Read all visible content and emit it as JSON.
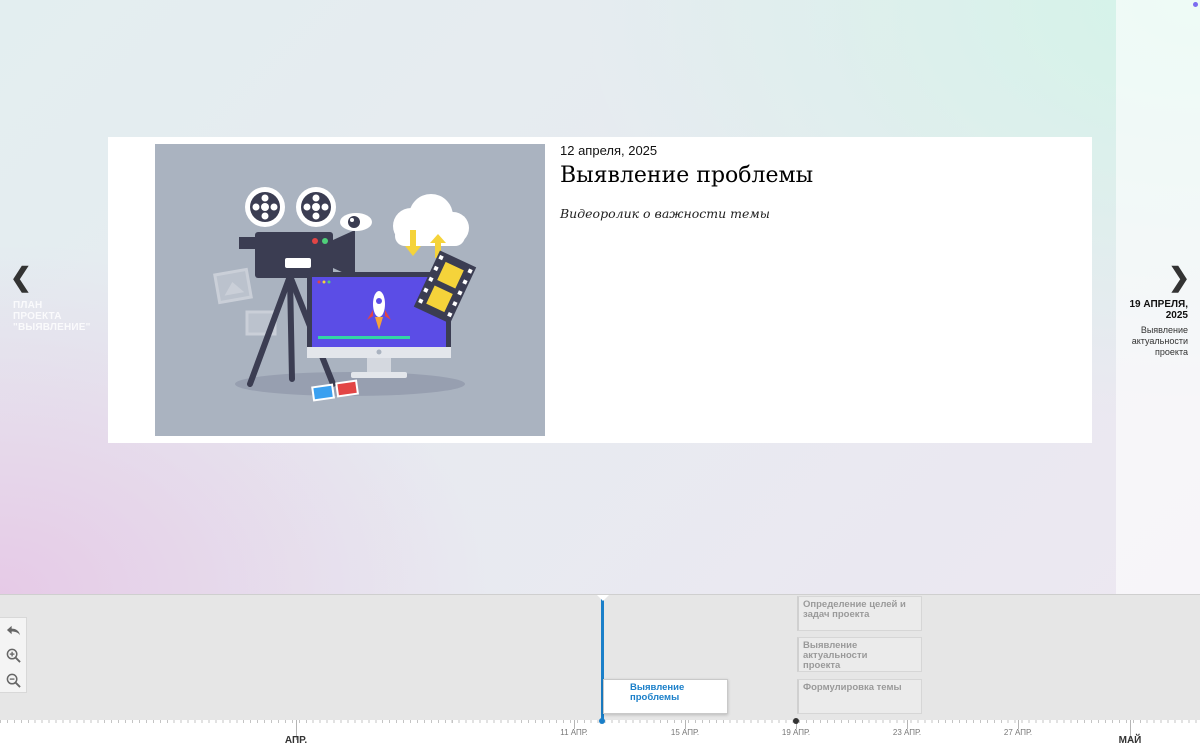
{
  "slide": {
    "date": "12 апреля, 2025",
    "title": "Выявление проблемы",
    "description": "Видеоролик о важности темы",
    "media_icons": [
      "film-camera-icon",
      "monitor-icon",
      "rocket-icon",
      "cloud-icon",
      "eye-icon",
      "film-strip-icon",
      "3d-glasses-icon"
    ]
  },
  "nav": {
    "prev": {
      "title_lines": [
        "ПЛАН",
        "ПРОЕКТА",
        "\"ВЫЯВЛЕНИЕ\""
      ],
      "icon": "chevron-left-icon"
    },
    "next": {
      "date_lines": [
        "19 АПРЕЛЯ,",
        "2025"
      ],
      "title_lines": [
        "Выявление",
        "актуальности",
        "проекта"
      ],
      "icon": "chevron-right-icon"
    }
  },
  "toolbar": {
    "buttons": [
      {
        "name": "back",
        "icon": "undo-arrow-icon"
      },
      {
        "name": "zoom-in",
        "icon": "zoom-in-icon"
      },
      {
        "name": "zoom-out",
        "icon": "zoom-out-icon"
      }
    ]
  },
  "events": {
    "active": {
      "title_lines": [
        "Выявление",
        "проблемы"
      ]
    },
    "others": [
      {
        "title_lines": [
          "Определение целей и",
          "задач проекта"
        ]
      },
      {
        "title_lines": [
          "Выявление актуальности",
          "проекта"
        ]
      },
      {
        "title_lines": [
          "Формулировка темы"
        ]
      }
    ]
  },
  "axis": {
    "months": [
      "АПР.",
      "МАЙ"
    ],
    "days": [
      "11 АПР.",
      "15 АПР.",
      "19 АПР.",
      "23 АПР.",
      "27 АПР."
    ]
  },
  "colors": {
    "accent": "#1a7fc9",
    "media_bg": "#aab3c0",
    "screen": "#5b4de6"
  }
}
